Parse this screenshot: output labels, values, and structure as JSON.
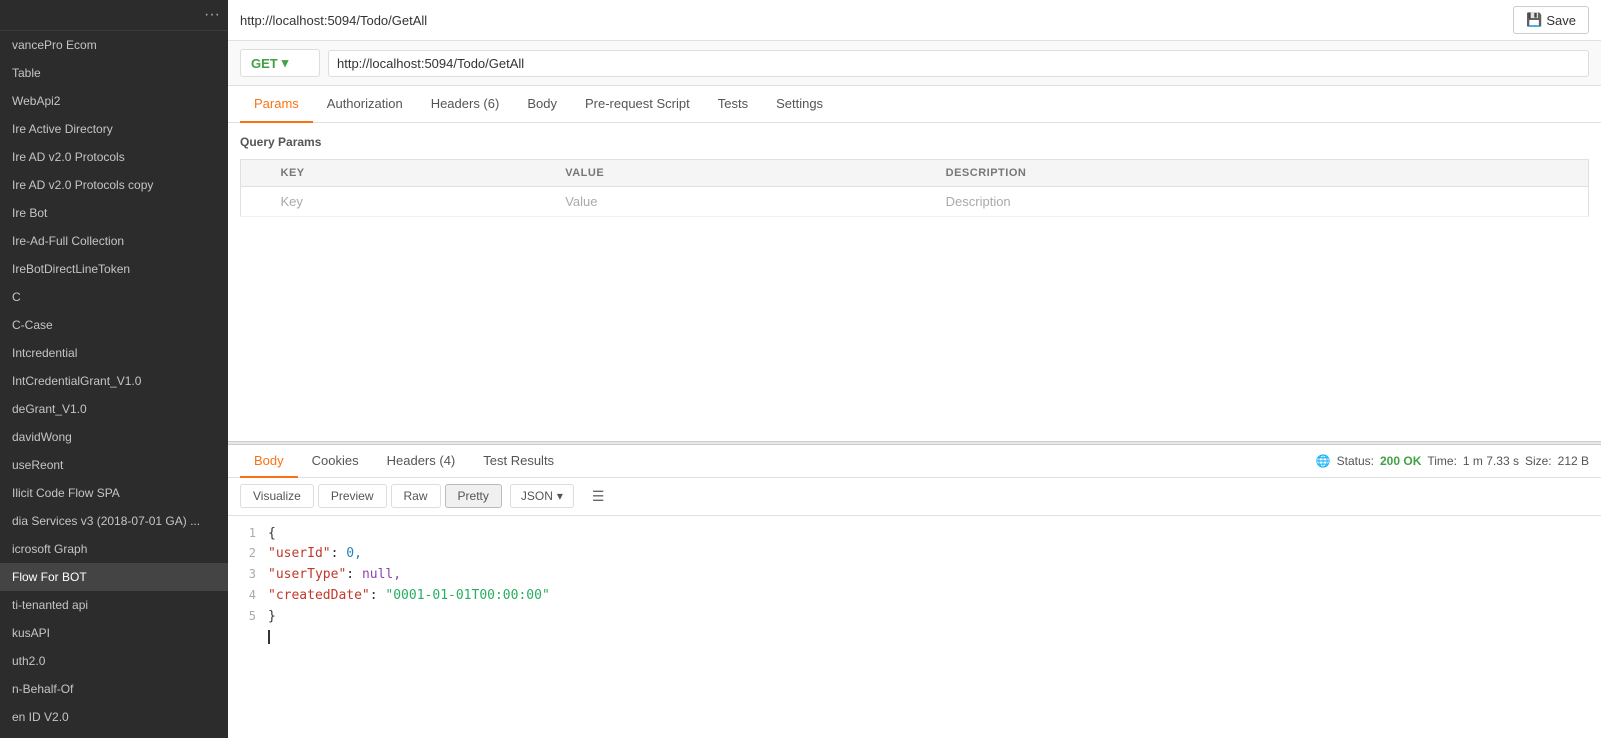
{
  "sidebar": {
    "dots": "···",
    "items": [
      {
        "label": "vancePro Ecom",
        "active": false
      },
      {
        "label": "Table",
        "active": false
      },
      {
        "label": "WebApi2",
        "active": false
      },
      {
        "label": "Ire Active Directory",
        "active": false
      },
      {
        "label": "Ire AD v2.0 Protocols",
        "active": false
      },
      {
        "label": "Ire AD v2.0 Protocols copy",
        "active": false
      },
      {
        "label": "Ire Bot",
        "active": false
      },
      {
        "label": "Ire-Ad-Full Collection",
        "active": false
      },
      {
        "label": "IreBotDirectLineToken",
        "active": false
      },
      {
        "label": "C",
        "active": false
      },
      {
        "label": "C-Case",
        "active": false
      },
      {
        "label": "Intcredential",
        "active": false
      },
      {
        "label": "IntCredentialGrant_V1.0",
        "active": false
      },
      {
        "label": "deGrant_V1.0",
        "active": false
      },
      {
        "label": "davidWong",
        "active": false
      },
      {
        "label": "useReont",
        "active": false
      },
      {
        "label": "Ilicit Code Flow SPA",
        "active": false
      },
      {
        "label": "dia Services v3 (2018-07-01 GA) ...",
        "active": false
      },
      {
        "label": "icrosoft Graph",
        "active": false
      },
      {
        "label": "Flow For BOT",
        "active": true
      },
      {
        "label": "ti-tenanted api",
        "active": false
      },
      {
        "label": "kusAPI",
        "active": false
      },
      {
        "label": "uth2.0",
        "active": false
      },
      {
        "label": "n-Behalf-Of",
        "active": false
      },
      {
        "label": "en ID V2.0",
        "active": false
      }
    ]
  },
  "topbar": {
    "title": "http://localhost:5094/Todo/GetAll",
    "save_label": "Save"
  },
  "url_bar": {
    "method": "GET",
    "url": "http://localhost:5094/Todo/GetAll"
  },
  "tabs": [
    {
      "label": "Params",
      "active": true
    },
    {
      "label": "Authorization",
      "active": false
    },
    {
      "label": "Headers (6)",
      "active": false
    },
    {
      "label": "Body",
      "active": false
    },
    {
      "label": "Pre-request Script",
      "active": false
    },
    {
      "label": "Tests",
      "active": false
    },
    {
      "label": "Settings",
      "active": false
    }
  ],
  "query_params": {
    "heading": "Query Params",
    "columns": [
      "KEY",
      "VALUE",
      "DESCRIPTION"
    ],
    "placeholder_key": "Key",
    "placeholder_value": "Value",
    "placeholder_desc": "Description"
  },
  "response_tabs": [
    {
      "label": "Body",
      "active": true
    },
    {
      "label": "Cookies",
      "active": false
    },
    {
      "label": "Headers (4)",
      "active": false
    },
    {
      "label": "Test Results",
      "active": false
    }
  ],
  "response_status": {
    "status_label": "Status:",
    "status_code": "200",
    "status_text": "OK",
    "time_label": "Time:",
    "time_value": "1 m 7.33 s",
    "size_label": "Size:",
    "size_value": "212 B"
  },
  "format_buttons": [
    {
      "label": "Pretty",
      "active": true
    },
    {
      "label": "Raw",
      "active": false
    },
    {
      "label": "Preview",
      "active": false
    },
    {
      "label": "Visualize",
      "active": false
    }
  ],
  "json_dropdown": {
    "label": "JSON"
  },
  "response_body": {
    "lines": [
      {
        "num": "1",
        "content": "{",
        "type": "brace"
      },
      {
        "num": "2",
        "content": "\"userId\": 0,",
        "type": "key-number"
      },
      {
        "num": "3",
        "content": "\"userType\": null,",
        "type": "key-null"
      },
      {
        "num": "4",
        "content": "\"createdDate\": \"0001-01-01T00:00:00\"",
        "type": "key-string"
      },
      {
        "num": "5",
        "content": "}",
        "type": "brace"
      }
    ]
  }
}
